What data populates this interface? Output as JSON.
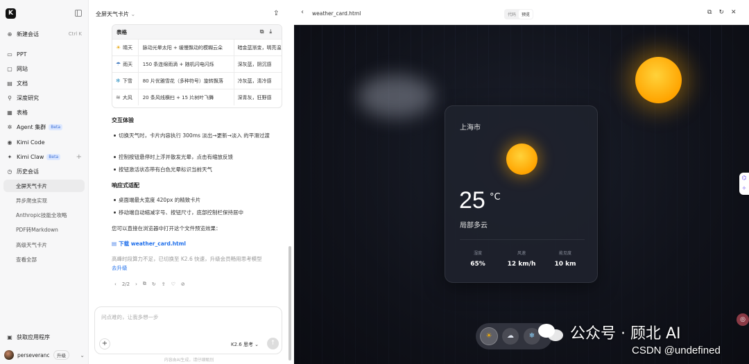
{
  "sidebar": {
    "logo": "K",
    "new_chat": {
      "label": "新建会话",
      "shortcut": "Ctrl  K"
    },
    "items": [
      {
        "label": "PPT",
        "icon": "ppt-icon"
      },
      {
        "label": "网站",
        "icon": "website-icon"
      },
      {
        "label": "文档",
        "icon": "document-icon"
      },
      {
        "label": "深度研究",
        "icon": "research-icon"
      },
      {
        "label": "表格",
        "icon": "table-icon"
      },
      {
        "label": "Agent 集群",
        "icon": "agent-icon",
        "badge": "Beta"
      },
      {
        "label": "Kimi Code",
        "icon": "code-icon"
      },
      {
        "label": "Kimi Claw",
        "icon": "claw-icon",
        "badge": "Beta"
      },
      {
        "label": "历史会话",
        "icon": "history-icon"
      }
    ],
    "history": [
      "全屏天气卡片",
      "异步爬虫实现",
      "Anthropic技能全攻略",
      "PDF转Markdown",
      "高级天气卡片",
      "查看全部"
    ],
    "get_app": "获取应用程序",
    "user": {
      "name": "perseveranc...",
      "upgrade": "升级"
    }
  },
  "chat": {
    "title": "全屏天气卡片",
    "table": {
      "title": "表格",
      "rows": [
        {
          "icon": "☀",
          "name": "晴天",
          "effect": "脉动光晕太阳 + 缓慢飘动的模糊云朵",
          "mood": "暗金蓝渐变，明亮温"
        },
        {
          "icon": "☂",
          "name": "雨天",
          "effect": "150 条连绵雨滴 + 随机闪电闪烁",
          "mood": "深灰蓝，阴沉感"
        },
        {
          "icon": "❄",
          "name": "下雪",
          "effect": "80 片优雅雪花（多种符号）旋转飘落",
          "mood": "冷灰蓝，清冷感"
        },
        {
          "icon": "≋",
          "name": "大风",
          "effect": "20 条风线横扫 + 15 片树叶飞舞",
          "mood": "深青灰，狂野感"
        }
      ]
    },
    "interaction": {
      "heading": "交互体验",
      "bullets": [
        "切换天气时，卡片内容执行 300ms 淡出→更新→淡入 的平滑过渡",
        "控制按钮悬停时上浮并散发光晕，点击有缩放反馈",
        "按钮激活状态带有白色光晕标识当前天气"
      ]
    },
    "responsive": {
      "heading": "响应式适配",
      "bullets": [
        "桌面端最大宽度 420px 的精致卡片",
        "移动端自动缩减字号、按钮尺寸，底部控制栏保持居中"
      ]
    },
    "open_hint": "您可以直接在浏览器中打开这个文件预览效果：",
    "download": {
      "prefix": "下载",
      "file": "weather_card.html"
    },
    "upgrade_hint": "高峰时段算力不足，已切换至 K2.6 快速，升级会员畅用思考模型",
    "upgrade_link": "去升级",
    "pager": "2/2",
    "input_placeholder": "问点难的，让我多想一步",
    "model": "K2.6 思考",
    "footer": "内容由AI生成，请仔细甄别"
  },
  "preview": {
    "filename": "weather_card.html",
    "tabs": [
      "代码",
      "预览"
    ],
    "active_tab": "预览",
    "card": {
      "city": "上海市",
      "temperature": "25",
      "unit": "°C",
      "condition": "局部多云",
      "stats": [
        {
          "label": "湿度",
          "value": "65%"
        },
        {
          "label": "风速",
          "value": "12 km/h"
        },
        {
          "label": "能见度",
          "value": "10 km"
        }
      ]
    },
    "controls": [
      {
        "icon": "sun-icon",
        "glyph": "☀"
      },
      {
        "icon": "cloud-icon",
        "glyph": "☁"
      },
      {
        "icon": "snow-icon",
        "glyph": "❄"
      }
    ]
  },
  "watermark": {
    "line1": "公众号 · 顾北 AI",
    "line2": "CSDN @undefined"
  },
  "colors": {
    "accent": "#1f6feb",
    "sun": "#ffa400",
    "stage_bg": "#10121a"
  }
}
